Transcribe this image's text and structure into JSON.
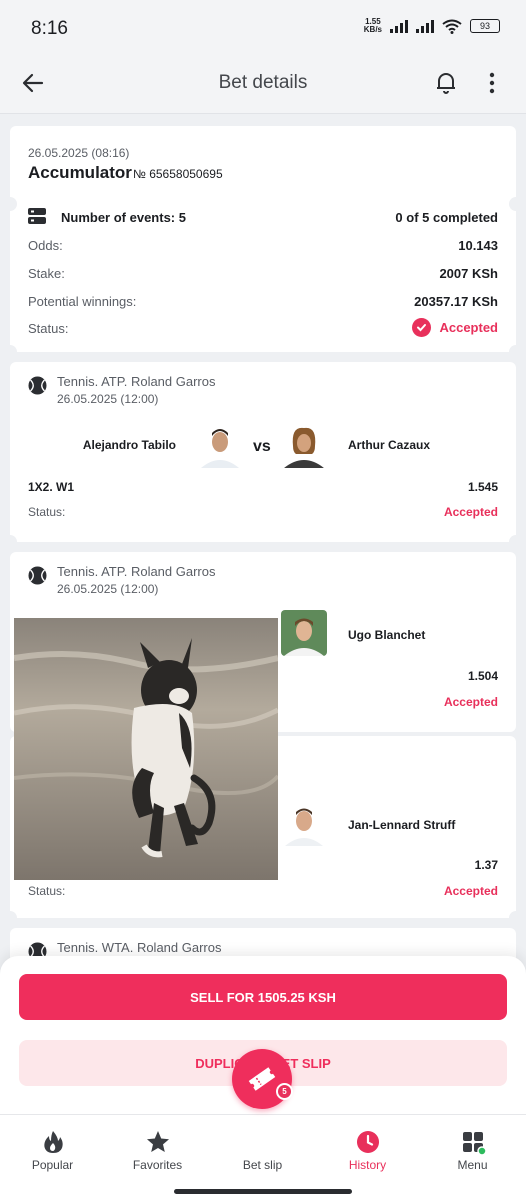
{
  "status_bar": {
    "time": "8:16",
    "net_speed": "1.55",
    "net_unit": "KB/s",
    "battery": "93"
  },
  "header": {
    "title": "Bet details"
  },
  "summary": {
    "date": "26.05.2025 (08:16)",
    "type": "Accumulator",
    "number": "№ 65658050695"
  },
  "info": {
    "events_label": "Number of events: 5",
    "events_value": "0 of 5 completed",
    "odds_label": "Odds:",
    "odds_value": "10.143",
    "stake_label": "Stake:",
    "stake_value": "2007 KSh",
    "potential_label": "Potential winnings:",
    "potential_value": "20357.17 KSh",
    "status_label": "Status:",
    "status_value": "Accepted"
  },
  "events": [
    {
      "league": "Tennis. ATP. Roland Garros",
      "date": "26.05.2025 (12:00)",
      "player1": "Alejandro Tabilo",
      "vs": "vs",
      "player2": "Arthur Cazaux",
      "market": "1X2. W1",
      "odd": "1.545",
      "status_label": "Status:",
      "status": "Accepted"
    },
    {
      "league": "Tennis. ATP. Roland Garros",
      "date": "26.05.2025 (12:00)",
      "player2": "Ugo Blanchet",
      "odd": "1.504",
      "status": "Accepted"
    },
    {
      "player2": "Jan-Lennard Struff",
      "odd": "1.37",
      "status_label": "Status:",
      "status": "Accepted"
    },
    {
      "league": "Tennis. WTA. Roland Garros"
    }
  ],
  "actions": {
    "sell": "SELL FOR 1505.25 KSH",
    "duplicate": "DUPLICATE BET SLIP"
  },
  "tabs": [
    {
      "label": "Popular",
      "icon": "fire-icon"
    },
    {
      "label": "Favorites",
      "icon": "star-icon"
    },
    {
      "label": "Bet slip",
      "icon": "ticket-icon",
      "badge": "5"
    },
    {
      "label": "History",
      "icon": "clock-icon"
    },
    {
      "label": "Menu",
      "icon": "grid-icon"
    }
  ],
  "colors": {
    "accent": "#ef2e5c",
    "accent_soft": "#fde7ea",
    "background": "#eef0f3"
  }
}
